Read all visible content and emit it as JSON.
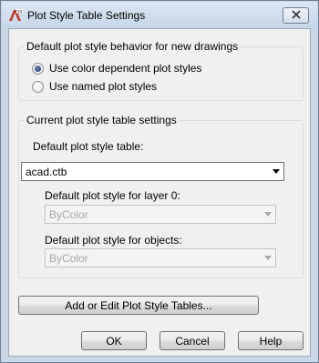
{
  "window": {
    "title": "Plot Style Table Settings",
    "app_icon": "autocad-icon",
    "close_icon": "close-icon"
  },
  "behavior_group": {
    "legend": "Default plot style behavior for new drawings",
    "options": [
      {
        "label": "Use color dependent plot styles",
        "selected": true
      },
      {
        "label": "Use named plot styles",
        "selected": false
      }
    ]
  },
  "current_group": {
    "legend": "Current plot style table settings",
    "table_label": "Default plot style table:",
    "table_value": "acad.ctb",
    "layer0_label": "Default plot style for layer 0:",
    "layer0_value": "ByColor",
    "objects_label": "Default plot style for objects:",
    "objects_value": "ByColor"
  },
  "buttons": {
    "add_edit": "Add or Edit Plot Style Tables...",
    "ok": "OK",
    "cancel": "Cancel",
    "help": "Help"
  }
}
